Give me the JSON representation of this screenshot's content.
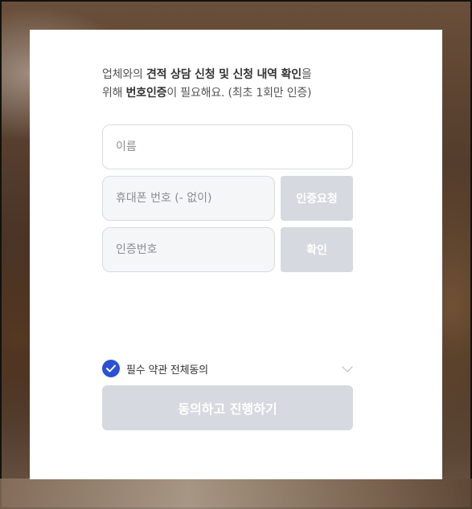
{
  "intro": {
    "line1_prefix": "업체와의 ",
    "line1_bold": "견적 상담 신청 및 신청 내역 확인",
    "line1_suffix": "을",
    "line2_prefix": "위해 ",
    "line2_bold": "번호인증",
    "line2_suffix": "이 필요해요. (최초 1회만 인증)"
  },
  "form": {
    "name_placeholder": "이름",
    "phone_placeholder": "휴대폰 번호 (- 없이)",
    "code_placeholder": "인증번호",
    "request_button": "인증요청",
    "confirm_button": "확인"
  },
  "agreement": {
    "label": "필수 약관 전체동의",
    "checked": true,
    "check_color": "#2b50d6"
  },
  "submit": {
    "label": "동의하고 진행하기"
  },
  "icons": [
    "check-icon",
    "chevron-down-icon"
  ]
}
